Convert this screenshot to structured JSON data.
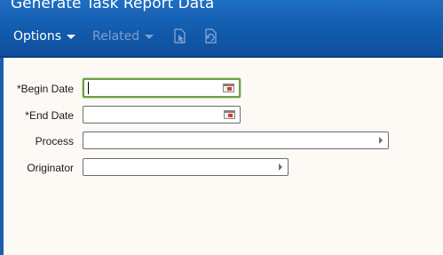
{
  "window": {
    "title": "Generate Task Report Data"
  },
  "toolbar": {
    "options_label": "Options",
    "related_label": "Related"
  },
  "form": {
    "begin_date": {
      "label": "*Begin Date",
      "value": ""
    },
    "end_date": {
      "label": "*End Date",
      "value": ""
    },
    "process": {
      "label": "Process",
      "value": ""
    },
    "originator": {
      "label": "Originator",
      "value": ""
    }
  },
  "colors": {
    "toolbar_blue": "#1463b6",
    "focus_green": "#6ea146",
    "background": "#fdfaf5"
  }
}
